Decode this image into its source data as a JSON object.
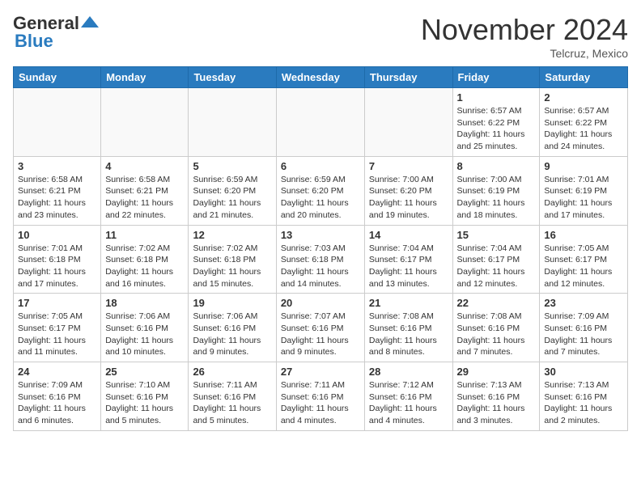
{
  "header": {
    "logo_general": "General",
    "logo_blue": "Blue",
    "month": "November 2024",
    "location": "Telcruz, Mexico"
  },
  "weekdays": [
    "Sunday",
    "Monday",
    "Tuesday",
    "Wednesday",
    "Thursday",
    "Friday",
    "Saturday"
  ],
  "weeks": [
    [
      {
        "day": "",
        "info": ""
      },
      {
        "day": "",
        "info": ""
      },
      {
        "day": "",
        "info": ""
      },
      {
        "day": "",
        "info": ""
      },
      {
        "day": "",
        "info": ""
      },
      {
        "day": "1",
        "info": "Sunrise: 6:57 AM\nSunset: 6:22 PM\nDaylight: 11 hours\nand 25 minutes."
      },
      {
        "day": "2",
        "info": "Sunrise: 6:57 AM\nSunset: 6:22 PM\nDaylight: 11 hours\nand 24 minutes."
      }
    ],
    [
      {
        "day": "3",
        "info": "Sunrise: 6:58 AM\nSunset: 6:21 PM\nDaylight: 11 hours\nand 23 minutes."
      },
      {
        "day": "4",
        "info": "Sunrise: 6:58 AM\nSunset: 6:21 PM\nDaylight: 11 hours\nand 22 minutes."
      },
      {
        "day": "5",
        "info": "Sunrise: 6:59 AM\nSunset: 6:20 PM\nDaylight: 11 hours\nand 21 minutes."
      },
      {
        "day": "6",
        "info": "Sunrise: 6:59 AM\nSunset: 6:20 PM\nDaylight: 11 hours\nand 20 minutes."
      },
      {
        "day": "7",
        "info": "Sunrise: 7:00 AM\nSunset: 6:20 PM\nDaylight: 11 hours\nand 19 minutes."
      },
      {
        "day": "8",
        "info": "Sunrise: 7:00 AM\nSunset: 6:19 PM\nDaylight: 11 hours\nand 18 minutes."
      },
      {
        "day": "9",
        "info": "Sunrise: 7:01 AM\nSunset: 6:19 PM\nDaylight: 11 hours\nand 17 minutes."
      }
    ],
    [
      {
        "day": "10",
        "info": "Sunrise: 7:01 AM\nSunset: 6:18 PM\nDaylight: 11 hours\nand 17 minutes."
      },
      {
        "day": "11",
        "info": "Sunrise: 7:02 AM\nSunset: 6:18 PM\nDaylight: 11 hours\nand 16 minutes."
      },
      {
        "day": "12",
        "info": "Sunrise: 7:02 AM\nSunset: 6:18 PM\nDaylight: 11 hours\nand 15 minutes."
      },
      {
        "day": "13",
        "info": "Sunrise: 7:03 AM\nSunset: 6:18 PM\nDaylight: 11 hours\nand 14 minutes."
      },
      {
        "day": "14",
        "info": "Sunrise: 7:04 AM\nSunset: 6:17 PM\nDaylight: 11 hours\nand 13 minutes."
      },
      {
        "day": "15",
        "info": "Sunrise: 7:04 AM\nSunset: 6:17 PM\nDaylight: 11 hours\nand 12 minutes."
      },
      {
        "day": "16",
        "info": "Sunrise: 7:05 AM\nSunset: 6:17 PM\nDaylight: 11 hours\nand 12 minutes."
      }
    ],
    [
      {
        "day": "17",
        "info": "Sunrise: 7:05 AM\nSunset: 6:17 PM\nDaylight: 11 hours\nand 11 minutes."
      },
      {
        "day": "18",
        "info": "Sunrise: 7:06 AM\nSunset: 6:16 PM\nDaylight: 11 hours\nand 10 minutes."
      },
      {
        "day": "19",
        "info": "Sunrise: 7:06 AM\nSunset: 6:16 PM\nDaylight: 11 hours\nand 9 minutes."
      },
      {
        "day": "20",
        "info": "Sunrise: 7:07 AM\nSunset: 6:16 PM\nDaylight: 11 hours\nand 9 minutes."
      },
      {
        "day": "21",
        "info": "Sunrise: 7:08 AM\nSunset: 6:16 PM\nDaylight: 11 hours\nand 8 minutes."
      },
      {
        "day": "22",
        "info": "Sunrise: 7:08 AM\nSunset: 6:16 PM\nDaylight: 11 hours\nand 7 minutes."
      },
      {
        "day": "23",
        "info": "Sunrise: 7:09 AM\nSunset: 6:16 PM\nDaylight: 11 hours\nand 7 minutes."
      }
    ],
    [
      {
        "day": "24",
        "info": "Sunrise: 7:09 AM\nSunset: 6:16 PM\nDaylight: 11 hours\nand 6 minutes."
      },
      {
        "day": "25",
        "info": "Sunrise: 7:10 AM\nSunset: 6:16 PM\nDaylight: 11 hours\nand 5 minutes."
      },
      {
        "day": "26",
        "info": "Sunrise: 7:11 AM\nSunset: 6:16 PM\nDaylight: 11 hours\nand 5 minutes."
      },
      {
        "day": "27",
        "info": "Sunrise: 7:11 AM\nSunset: 6:16 PM\nDaylight: 11 hours\nand 4 minutes."
      },
      {
        "day": "28",
        "info": "Sunrise: 7:12 AM\nSunset: 6:16 PM\nDaylight: 11 hours\nand 4 minutes."
      },
      {
        "day": "29",
        "info": "Sunrise: 7:13 AM\nSunset: 6:16 PM\nDaylight: 11 hours\nand 3 minutes."
      },
      {
        "day": "30",
        "info": "Sunrise: 7:13 AM\nSunset: 6:16 PM\nDaylight: 11 hours\nand 2 minutes."
      }
    ]
  ]
}
